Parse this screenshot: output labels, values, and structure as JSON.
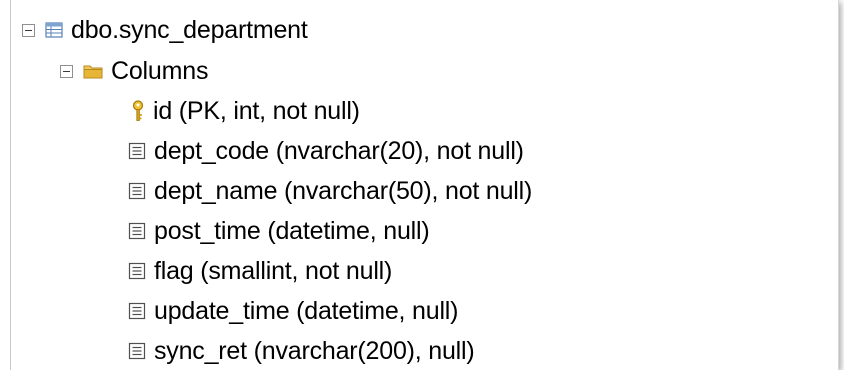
{
  "tree": {
    "table": {
      "label": "dbo.sync_department",
      "icon": "table-icon",
      "expanded": true
    },
    "columns_folder": {
      "label": "Columns",
      "icon": "folder-icon",
      "expanded": true
    },
    "columns": [
      {
        "label": "id (PK, int, not null)",
        "icon": "key-icon"
      },
      {
        "label": "dept_code (nvarchar(20), not null)",
        "icon": "column-icon"
      },
      {
        "label": "dept_name (nvarchar(50), not null)",
        "icon": "column-icon"
      },
      {
        "label": "post_time (datetime, null)",
        "icon": "column-icon"
      },
      {
        "label": "flag (smallint, not null)",
        "icon": "column-icon"
      },
      {
        "label": "update_time (datetime, null)",
        "icon": "column-icon"
      },
      {
        "label": "sync_ret (nvarchar(200), null)",
        "icon": "column-icon"
      }
    ]
  },
  "colors": {
    "folder": "#e8b637",
    "key": "#d4a017",
    "table_icon": "#5a82b8"
  }
}
